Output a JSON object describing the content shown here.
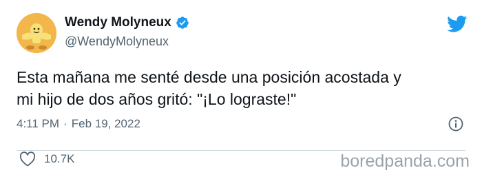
{
  "author": {
    "display_name": "Wendy Molyneux",
    "handle": "@WendyMolyneux",
    "verified_icon": "verified-badge-icon",
    "avatar_icon": "avatar"
  },
  "tweet": {
    "text_line1": "Esta mañana me senté desde una posición acostada y",
    "text_line2": "mi hijo de dos años gritó: \"¡Lo lograste!\"",
    "time": "4:11 PM",
    "separator": "·",
    "date": "Feb 19, 2022",
    "like_count": "10.7K"
  },
  "branding": {
    "logo_icon": "twitter-bird-icon",
    "watermark": "boredpanda.com"
  },
  "colors": {
    "twitter_blue": "#1d9bf0",
    "secondary_text": "#536471",
    "watermark": "#9aa3aa"
  }
}
